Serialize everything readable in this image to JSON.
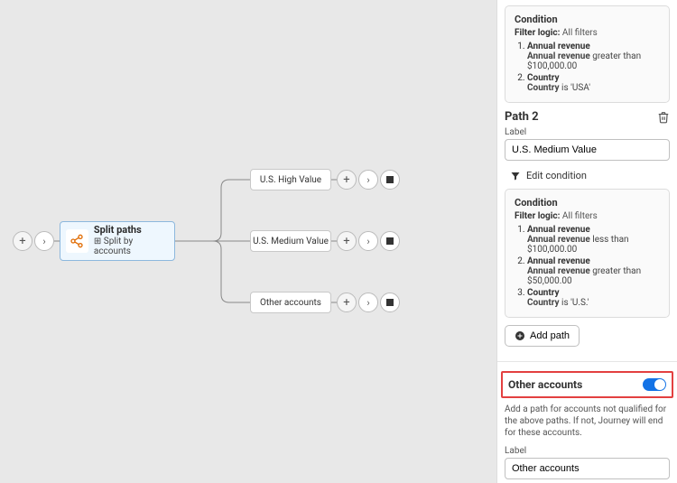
{
  "canvas": {
    "split_node": {
      "title": "Split paths",
      "subtitle": "Split by accounts",
      "sub_icon": "⊞"
    },
    "paths": [
      {
        "label": "U.S. High Value"
      },
      {
        "label": "U.S. Medium Value"
      },
      {
        "label": "Other accounts"
      }
    ]
  },
  "panel": {
    "condition1": {
      "title": "Condition",
      "filter_label": "Filter logic:",
      "filter_value": "All filters",
      "items": [
        {
          "field": "Annual revenue",
          "rule_field": "Annual revenue",
          "rule_text": "greater than $100,000.00"
        },
        {
          "field": "Country",
          "rule_field": "Country",
          "rule_text": "is 'USA'"
        }
      ]
    },
    "path2": {
      "title": "Path 2",
      "label_caption": "Label",
      "label_value": "U.S. Medium Value",
      "edit_cond": "Edit condition"
    },
    "condition2": {
      "title": "Condition",
      "filter_label": "Filter logic:",
      "filter_value": "All filters",
      "items": [
        {
          "field": "Annual revenue",
          "rule_field": "Annual revenue",
          "rule_text": "less than $100,000.00"
        },
        {
          "field": "Annual revenue",
          "rule_field": "Annual revenue",
          "rule_text": "greater than $50,000.00"
        },
        {
          "field": "Country",
          "rule_field": "Country",
          "rule_text": "is 'U.S.'"
        }
      ]
    },
    "add_path": "Add path",
    "other_accounts": {
      "title": "Other accounts",
      "helper": "Add a path for accounts not qualified for the above paths. If not, Journey will end for these accounts.",
      "label_caption": "Label",
      "label_value": "Other accounts"
    }
  }
}
